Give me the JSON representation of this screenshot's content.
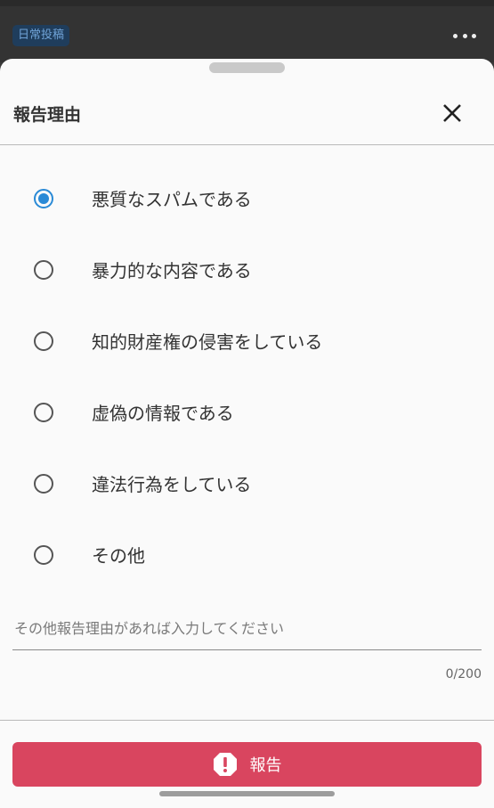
{
  "background": {
    "tag_label": "日常投稿"
  },
  "sheet": {
    "title": "報告理由",
    "options": [
      {
        "label": "悪質なスパムである",
        "selected": true
      },
      {
        "label": "暴力的な内容である",
        "selected": false
      },
      {
        "label": "知的財産権の侵害をしている",
        "selected": false
      },
      {
        "label": "虚偽の情報である",
        "selected": false
      },
      {
        "label": "違法行為をしている",
        "selected": false
      },
      {
        "label": "その他",
        "selected": false
      }
    ],
    "other_reason": {
      "placeholder": "その他報告理由があれば入力してください",
      "value": "",
      "counter": "0/200"
    },
    "report_button_label": "報告"
  },
  "colors": {
    "accent": "#2a8ad6",
    "report": "#d9455f"
  }
}
